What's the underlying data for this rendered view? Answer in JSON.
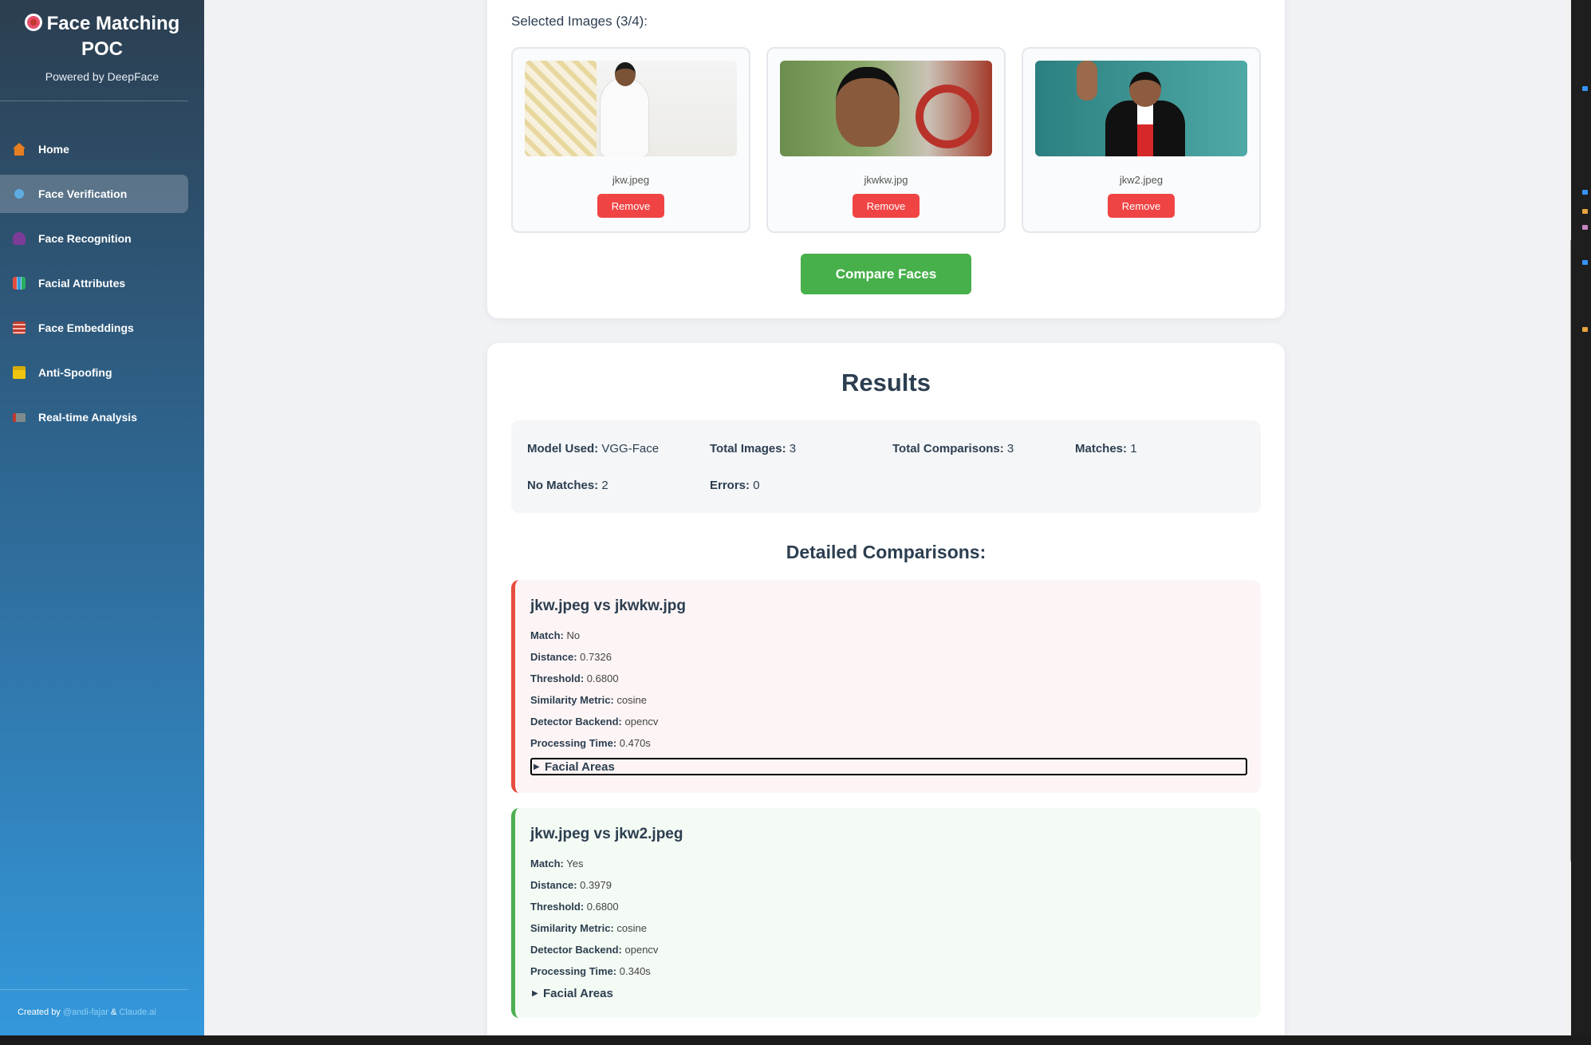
{
  "app": {
    "title": "Face Matching POC",
    "subtitle": "Powered by DeepFace"
  },
  "nav": [
    {
      "label": "Home",
      "icon": "house-icon",
      "color": "#e67e22"
    },
    {
      "label": "Face Verification",
      "icon": "circle-icon",
      "color": "#5dade2",
      "active": true
    },
    {
      "label": "Face Recognition",
      "icon": "user-icon",
      "color": "#8e44ad"
    },
    {
      "label": "Facial Attributes",
      "icon": "bar-chart-icon",
      "color": "#e74c3c"
    },
    {
      "label": "Face Embeddings",
      "icon": "grid-icon",
      "color": "#c0392b"
    },
    {
      "label": "Anti-Spoofing",
      "icon": "lock-icon",
      "color": "#f1c40f"
    },
    {
      "label": "Real-time Analysis",
      "icon": "camera-icon",
      "color": "#c0392b"
    }
  ],
  "footer": {
    "prefix": "Created by",
    "author": "@andi-fajar",
    "amp": "&",
    "tool": "Claude.ai"
  },
  "upload": {
    "selected_title": "Selected Images (3/4):",
    "images": [
      {
        "name": "jkw.jpeg",
        "remove_label": "Remove"
      },
      {
        "name": "jkwkw.jpg",
        "remove_label": "Remove"
      },
      {
        "name": "jkw2.jpeg",
        "remove_label": "Remove"
      }
    ],
    "compare_label": "Compare Faces"
  },
  "results": {
    "title": "Results",
    "summary": {
      "model_label": "Model Used:",
      "model_value": "VGG-Face",
      "total_images_label": "Total Images:",
      "total_images_value": "3",
      "total_comparisons_label": "Total Comparisons:",
      "total_comparisons_value": "3",
      "matches_label": "Matches:",
      "matches_value": "1",
      "no_matches_label": "No Matches:",
      "no_matches_value": "2",
      "errors_label": "Errors:",
      "errors_value": "0"
    },
    "detailed_title": "Detailed Comparisons:",
    "comparisons": [
      {
        "title": "jkw.jpeg vs jkwkw.jpg",
        "match_label": "Match:",
        "match": "No",
        "distance_label": "Distance:",
        "distance": "0.7326",
        "threshold_label": "Threshold:",
        "threshold": "0.6800",
        "metric_label": "Similarity Metric:",
        "metric": "cosine",
        "detector_label": "Detector Backend:",
        "detector": "opencv",
        "time_label": "Processing Time:",
        "time": "0.470s",
        "facial_areas_label": "Facial Areas"
      },
      {
        "title": "jkw.jpeg vs jkw2.jpeg",
        "match_label": "Match:",
        "match": "Yes",
        "distance_label": "Distance:",
        "distance": "0.3979",
        "threshold_label": "Threshold:",
        "threshold": "0.6800",
        "metric_label": "Similarity Metric:",
        "metric": "cosine",
        "detector_label": "Detector Backend:",
        "detector": "opencv",
        "time_label": "Processing Time:",
        "time": "0.340s",
        "facial_areas_label": "Facial Areas"
      }
    ]
  }
}
